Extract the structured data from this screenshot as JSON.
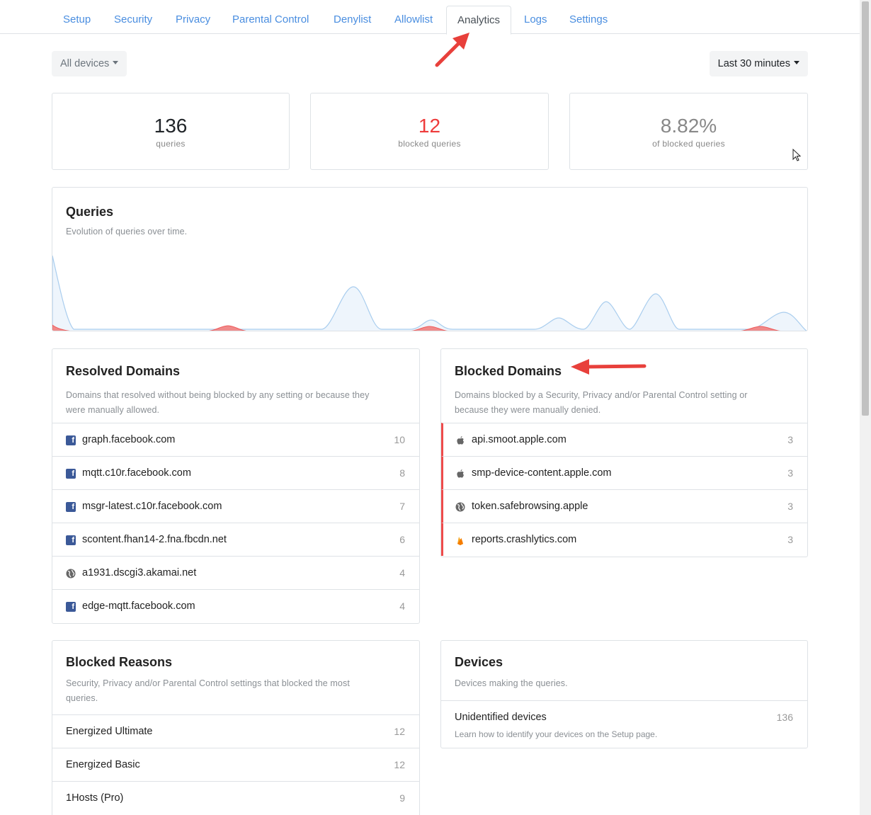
{
  "tabs": [
    "Setup",
    "Security",
    "Privacy",
    "Parental Control",
    "Denylist",
    "Allowlist",
    "Analytics",
    "Logs",
    "Settings"
  ],
  "active_tab": "Analytics",
  "filters": {
    "devices": "All devices",
    "range": "Last 30 minutes"
  },
  "stats": [
    {
      "value": "136",
      "label": "queries",
      "color": "#212529"
    },
    {
      "value": "12",
      "label": "blocked queries",
      "color": "#ee3b3b"
    },
    {
      "value": "8.82%",
      "label": "of blocked queries",
      "color": "#888888"
    }
  ],
  "queries_card": {
    "title": "Queries",
    "description": "Evolution of queries over time."
  },
  "resolved": {
    "title": "Resolved Domains",
    "description_line1": "Domains that resolved without being blocked by any setting or because they",
    "description_line2": "were manually allowed.",
    "rows": [
      {
        "icon": "facebook-icon",
        "domain": "graph.facebook.com",
        "count": "10"
      },
      {
        "icon": "facebook-icon",
        "domain": "mqtt.c10r.facebook.com",
        "count": "8"
      },
      {
        "icon": "facebook-icon",
        "domain": "msgr-latest.c10r.facebook.com",
        "count": "7"
      },
      {
        "icon": "facebook-icon",
        "domain": "scontent.fhan14-2.fna.fbcdn.net",
        "count": "6"
      },
      {
        "icon": "globe-icon",
        "domain": "a1931.dscgi3.akamai.net",
        "count": "4"
      },
      {
        "icon": "facebook-icon",
        "domain": "edge-mqtt.facebook.com",
        "count": "4"
      }
    ]
  },
  "blocked": {
    "title": "Blocked Domains",
    "description_line1": "Domains blocked by a Security, Privacy and/or Parental Control setting or",
    "description_line2": "because they were manually denied.",
    "accent_color": "#ee4b4b",
    "rows": [
      {
        "icon": "apple-icon",
        "domain": "api.smoot.apple.com",
        "count": "3"
      },
      {
        "icon": "apple-icon",
        "domain": "smp-device-content.apple.com",
        "count": "3"
      },
      {
        "icon": "globe-icon",
        "domain": "token.safebrowsing.apple",
        "count": "3"
      },
      {
        "icon": "firebase-icon",
        "domain": "reports.crashlytics.com",
        "count": "3"
      }
    ]
  },
  "reasons": {
    "title": "Blocked Reasons",
    "description_line1": "Security, Privacy and/or Parental Control settings that blocked the most",
    "description_line2": "queries.",
    "rows": [
      {
        "name": "Energized Ultimate",
        "count": "12"
      },
      {
        "name": "Energized Basic",
        "count": "12"
      },
      {
        "name": "1Hosts (Pro)",
        "count": "9"
      }
    ]
  },
  "devices": {
    "title": "Devices",
    "description": "Devices making the queries.",
    "rows": [
      {
        "name": "Unidentified devices",
        "hint": "Learn how to identify your devices on the Setup page.",
        "count": "136"
      }
    ]
  }
}
